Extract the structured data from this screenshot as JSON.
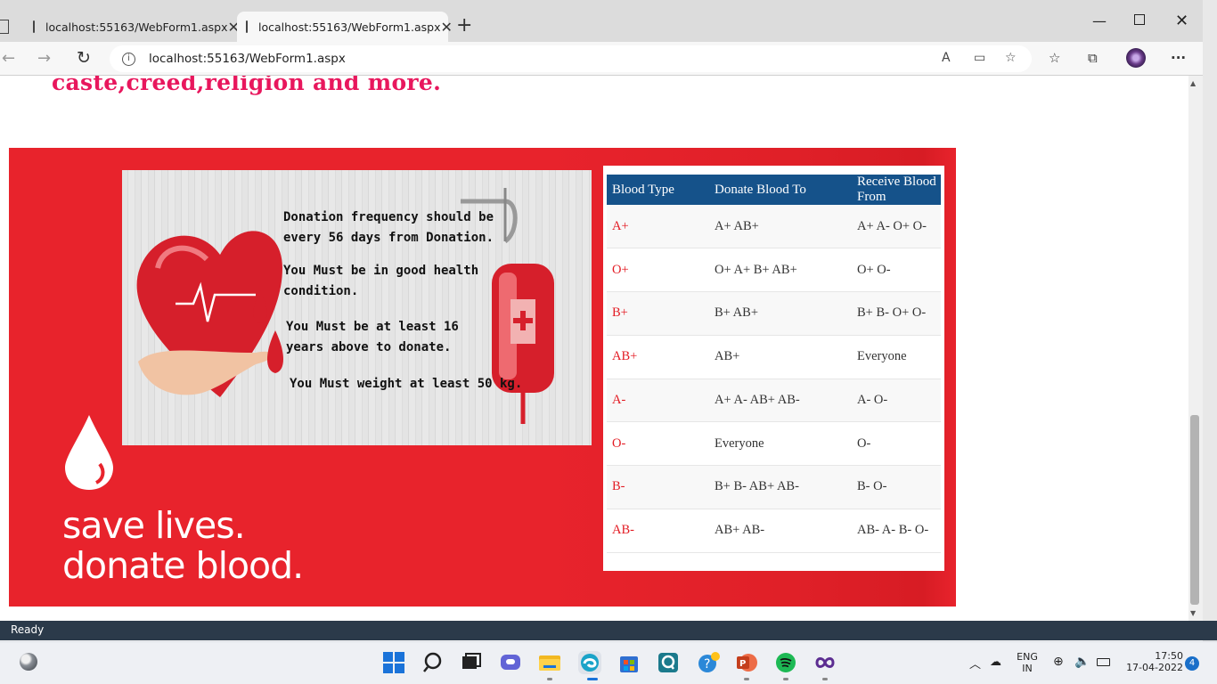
{
  "browser": {
    "tabs": [
      {
        "title": "localhost:55163/WebForm1.aspx"
      },
      {
        "title": "localhost:55163/WebForm1.aspx"
      }
    ],
    "url": "localhost:55163/WebForm1.aspx",
    "status": "Ready"
  },
  "page": {
    "heading_fragment": "caste,creed,religion and more.",
    "poster": {
      "line1": "Donation frequency should be",
      "line2": "every 56 days from Donation.",
      "line3": "You Must be in good health",
      "line4": "condition.",
      "line5": "You Must be at least 16",
      "line6": "years above to donate.",
      "line7": "You Must weight at least 50 kg."
    },
    "slogan_line1": "save lives.",
    "slogan_line2": "donate blood.",
    "blood_table": {
      "headers": [
        "Blood Type",
        "Donate Blood To",
        "Receive Blood From"
      ],
      "rows": [
        [
          "A+",
          "A+ AB+",
          "A+ A- O+ O-"
        ],
        [
          "O+",
          "O+ A+ B+ AB+",
          "O+ O-"
        ],
        [
          "B+",
          "B+ AB+",
          "B+ B- O+ O-"
        ],
        [
          "AB+",
          "AB+",
          "Everyone"
        ],
        [
          "A-",
          "A+ A- AB+ AB-",
          "A- O-"
        ],
        [
          "O-",
          "Everyone",
          "O-"
        ],
        [
          "B-",
          "B+ B- AB+ AB-",
          "B- O-"
        ],
        [
          "AB-",
          "AB+ AB-",
          "AB- A- B- O-"
        ]
      ]
    }
  },
  "taskbar": {
    "lang_line1": "ENG",
    "lang_line2": "IN",
    "time": "17:50",
    "date": "17-04-2022",
    "notification_count": "4"
  },
  "colors": {
    "banner_red": "#e8232c",
    "heading_pink": "#e8175d",
    "table_header_blue": "#15528a"
  }
}
